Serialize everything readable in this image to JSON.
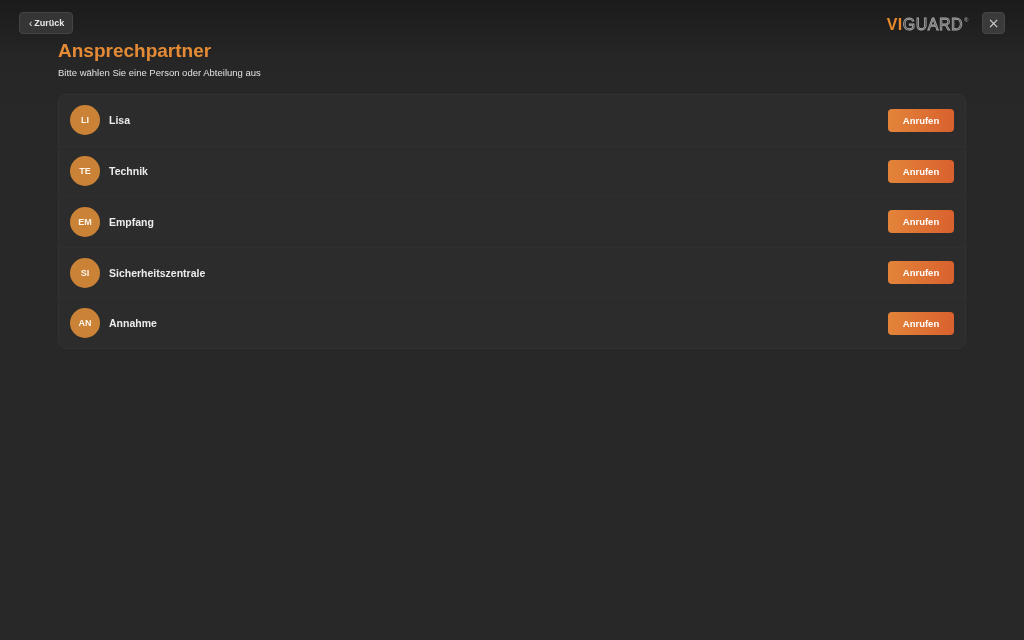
{
  "header": {
    "back_button": {
      "icon": "‹",
      "label": "Zurück"
    },
    "logo": {
      "accent": "VI",
      "rest": "GUARD",
      "mark": "®"
    },
    "close_button": {
      "label": "×"
    }
  },
  "page": {
    "title": "Ansprechpartner",
    "subtitle": "Bitte wählen Sie eine Person oder Abteilung aus"
  },
  "contacts": [
    {
      "initials": "LI",
      "name": "Lisa",
      "action": "Anrufen"
    },
    {
      "initials": "TE",
      "name": "Technik",
      "action": "Anrufen"
    },
    {
      "initials": "EM",
      "name": "Empfang",
      "action": "Anrufen"
    },
    {
      "initials": "SI",
      "name": "Sicherheitszentrale",
      "action": "Anrufen"
    },
    {
      "initials": "AN",
      "name": "Annahme",
      "action": "Anrufen"
    }
  ]
}
